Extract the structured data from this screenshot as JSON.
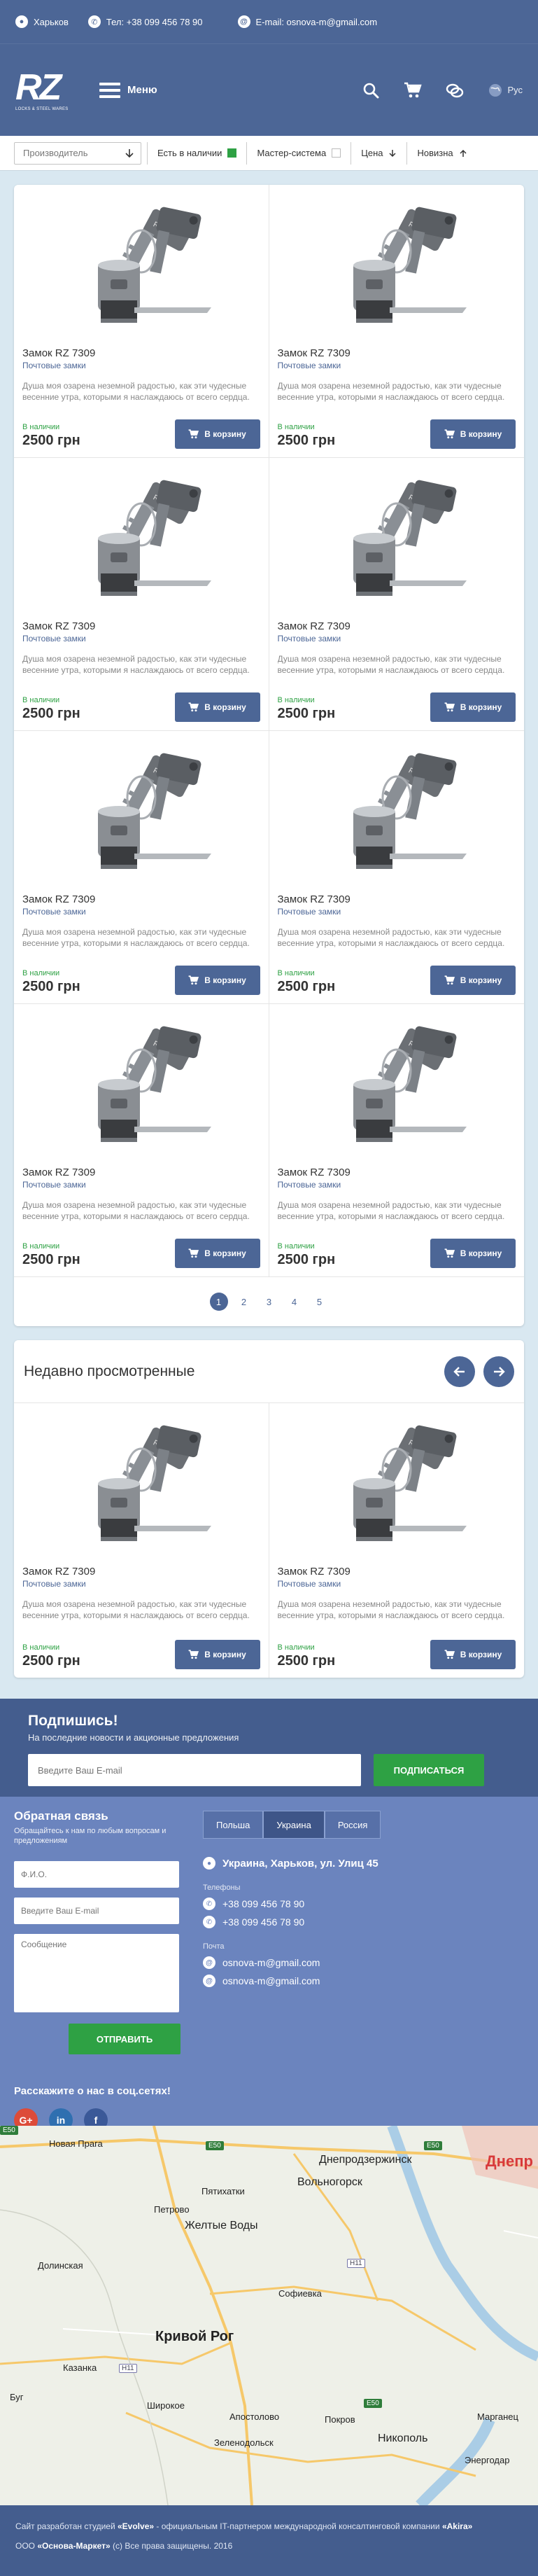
{
  "topbar": {
    "city": "Харьков",
    "phone": "Тел: +38 099 456 78 90",
    "email": "E-mail: osnova-m@gmail.com"
  },
  "header": {
    "logo_letters": "RZ",
    "logo_sub": "LOCKS & STEEL WARES",
    "menu_label": "Меню",
    "lang": "Рус"
  },
  "filters": {
    "manufacturer_placeholder": "Производитель",
    "in_stock": "Есть в наличии",
    "master_system": "Мастер-система",
    "price": "Цена",
    "novelty": "Новизна"
  },
  "product": {
    "name": "Замок RZ 7309",
    "category": "Почтовые замки",
    "desc": "Душа моя озарена неземной радостью, как эти чудесные весенние утра, которыми я наслаждаюсь от всего сердца.",
    "stock": "В наличии",
    "price": "2500 грн",
    "cart_label": "В корзину"
  },
  "pagination": [
    "1",
    "2",
    "3",
    "4",
    "5"
  ],
  "recent": {
    "title": "Недавно просмотренные"
  },
  "subscribe": {
    "title": "Подпишись!",
    "text": "На последние новости и акционные предложения",
    "placeholder": "Введите Ваш E-mail",
    "button": "ПОДПИСАТЬСЯ"
  },
  "feedback": {
    "title": "Обратная связь",
    "note": "Обращайтесь к нам по любым вопросам и предложениям",
    "name_placeholder": "Ф.И.О.",
    "email_placeholder": "Введите Ваш E-mail",
    "message_placeholder": "Сообщение",
    "send": "ОТПРАВИТЬ"
  },
  "social": {
    "title": "Расскажите о нас в соц.сетях!",
    "google": "G+",
    "linkedin": "in",
    "facebook": "f"
  },
  "contacts": {
    "tabs": [
      "Польша",
      "Украина",
      "Россия"
    ],
    "address": "Украина, Харьков, ул. Улиц 45",
    "phones_label": "Телефоны",
    "phones": [
      "+38 099 456 78 90",
      "+38 099 456 78 90"
    ],
    "mail_label": "Почта",
    "emails": [
      "osnova-m@gmail.com",
      "osnova-m@gmail.com"
    ]
  },
  "map": {
    "cities": {
      "new_praga": "Новая Прага",
      "dneprodz": "Днепродзержинск",
      "dnepr": "Днепр",
      "pyatikhatki": "Пятихатки",
      "volnogorsk": "Вольногорск",
      "petrovo": "Петрово",
      "zheltye_vody": "Желтые Воды",
      "dolinskaya": "Долинская",
      "sofievka": "Софиевка",
      "krivoy_rog": "Кривой Рог",
      "kazanka": "Казанка",
      "shirokoe": "Широкое",
      "apostolovo": "Апостолово",
      "pokrov": "Покров",
      "nikopol": "Никополь",
      "marganets": "Марганец",
      "zelenodolsk": "Зеленодольск",
      "energodar": "Энергодар",
      "bug": "Буг"
    },
    "roads": [
      "E50",
      "E50",
      "E50",
      "H11",
      "H11",
      "E50"
    ]
  },
  "footer": {
    "line1_pre": "Сайт разработан студией ",
    "studio": "«Evolve»",
    "line1_mid": " - официальным IT-партнером международной консалтинговой компании ",
    "company": "«Akira»",
    "copy_pre": "ООО ",
    "org": "«Основа-Маркет»",
    "copy_post": " (с) Все права защищены. 2016"
  },
  "colors": {
    "brand": "#4c6696",
    "accent_green": "#2ea144",
    "contact_bg": "#6b84be",
    "page_bg": "#d9e8f1"
  }
}
